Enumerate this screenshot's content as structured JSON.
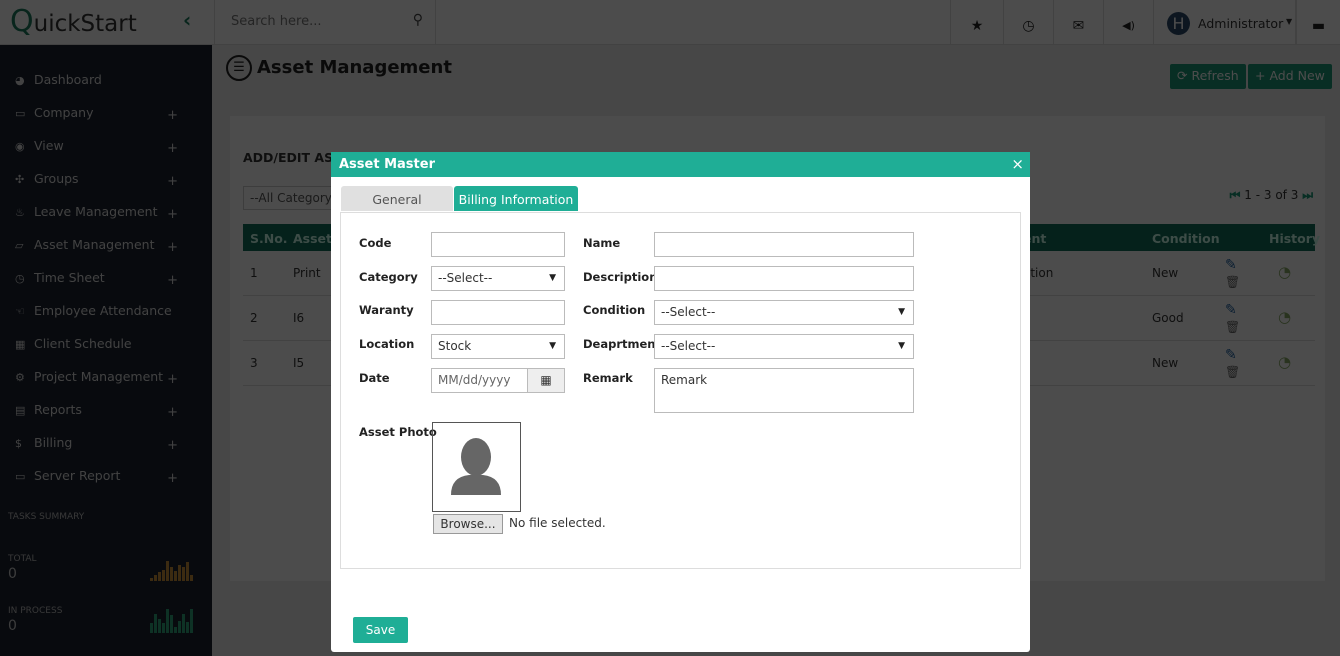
{
  "app": {
    "logo": "QuickStart",
    "search_placeholder": "Search here...",
    "user": "Administrator",
    "user_initial": "H"
  },
  "sidebar": {
    "items": [
      {
        "label": "Dashboard",
        "icon": "dashboard-icon",
        "glyph": "◕",
        "plus": false
      },
      {
        "label": "Company",
        "icon": "desktop-icon",
        "glyph": "▭",
        "plus": true
      },
      {
        "label": "View",
        "icon": "eye-icon",
        "glyph": "◉",
        "plus": true
      },
      {
        "label": "Groups",
        "icon": "groups-icon",
        "glyph": "✣",
        "plus": true
      },
      {
        "label": "Leave Management",
        "icon": "leave-icon",
        "glyph": "♨",
        "plus": true
      },
      {
        "label": "Asset Management",
        "icon": "folder-icon",
        "glyph": "▱",
        "plus": true
      },
      {
        "label": "Time Sheet",
        "icon": "clock-icon",
        "glyph": "◷",
        "plus": true
      },
      {
        "label": "Employee Attendance",
        "icon": "hand-icon",
        "glyph": "☜",
        "plus": false
      },
      {
        "label": "Client Schedule",
        "icon": "calendar-icon",
        "glyph": "▦",
        "plus": false
      },
      {
        "label": "Project Management",
        "icon": "cogs-icon",
        "glyph": "⚙",
        "plus": true
      },
      {
        "label": "Reports",
        "icon": "file-icon",
        "glyph": "▤",
        "plus": true
      },
      {
        "label": "Billing",
        "icon": "dollar-icon",
        "glyph": "$",
        "plus": true
      },
      {
        "label": "Server Report",
        "icon": "desktop-icon",
        "glyph": "▭",
        "plus": true
      }
    ],
    "tasks_title": "TASKS SUMMARY",
    "total_label": "TOTAL",
    "total_value": "0",
    "inprocess_label": "IN PROCESS",
    "inprocess_value": "0",
    "total_bars": [
      3,
      6,
      9,
      11,
      20,
      14,
      10,
      16,
      14,
      19,
      6
    ],
    "inprocess_bars": [
      10,
      19,
      14,
      10,
      24,
      18,
      6,
      12,
      19,
      11,
      24
    ]
  },
  "page": {
    "title": "Asset Management",
    "refresh": "Refresh",
    "add_new": "Add New",
    "panel_title": "ADD/EDIT ASSET",
    "category_filter": "--All Category--",
    "pager": "1 - 3 of 3"
  },
  "table": {
    "headers": [
      "S.No.",
      "Asset Code",
      "ent",
      "Condition",
      "History"
    ],
    "rows": [
      {
        "sno": "1",
        "code": "Print",
        "dept": "ation",
        "condition": "New"
      },
      {
        "sno": "2",
        "code": "I6",
        "dept": "",
        "condition": "Good"
      },
      {
        "sno": "3",
        "code": "I5",
        "dept": "g",
        "condition": "New"
      }
    ]
  },
  "modal": {
    "title": "Asset Master",
    "tabs": [
      "General",
      "Billing Information"
    ],
    "active_tab": "Billing Information",
    "fields": {
      "code_label": "Code",
      "code_value": "",
      "name_label": "Name",
      "name_value": "",
      "category_label": "Category",
      "category_value": "--Select--",
      "description_label": "Description",
      "description_value": "",
      "warranty_label": "Waranty",
      "warranty_value": "",
      "condition_label": "Condition",
      "condition_value": "--Select--",
      "location_label": "Location",
      "location_value": "Stock",
      "department_label": "Deaprtment",
      "department_value": "--Select--",
      "date_label": "Date",
      "date_placeholder": "MM/dd/yyyy",
      "remark_label": "Remark",
      "remark_placeholder": "Remark",
      "photo_label": "Asset Photo",
      "browse": "Browse...",
      "no_file": "No file selected."
    },
    "save": "Save"
  },
  "colors": {
    "accent": "#1fae96",
    "dark_green": "#0f6e59",
    "sidebar": "#0b0e13"
  }
}
